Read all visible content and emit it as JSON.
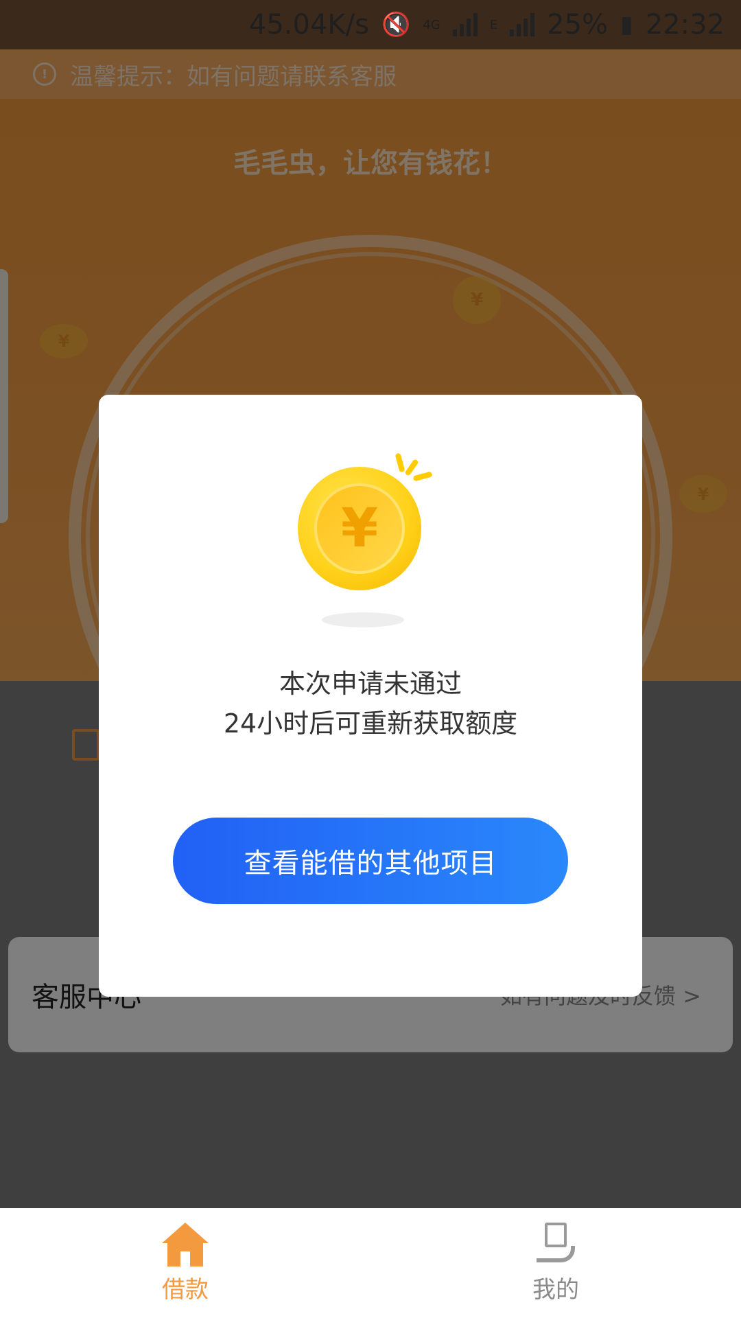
{
  "status_bar": {
    "network_speed": "45.04K/s",
    "network_type_1": "4G",
    "network_type_2": "E",
    "battery": "25%",
    "time": "22:32"
  },
  "notice": {
    "text": "温馨提示：如有问题请联系客服"
  },
  "hero": {
    "slogan": "毛毛虫，让您有钱花！",
    "coin_symbol": "¥"
  },
  "service": {
    "title": "客服中心",
    "link": "如有问题及时反馈 >"
  },
  "modal": {
    "coin_symbol": "¥",
    "line1": "本次申请未通过",
    "line2": "24小时后可重新获取额度",
    "button_label": "查看能借的其他项目"
  },
  "tabbar": {
    "tabs": [
      {
        "label": "借款",
        "icon": "home-icon",
        "active": true
      },
      {
        "label": "我的",
        "icon": "mine-icon",
        "active": false
      }
    ]
  },
  "colors": {
    "accent": "#f39a3f",
    "button_start": "#2160f5",
    "button_end": "#2a88fb",
    "inactive": "#8a8a8a"
  }
}
